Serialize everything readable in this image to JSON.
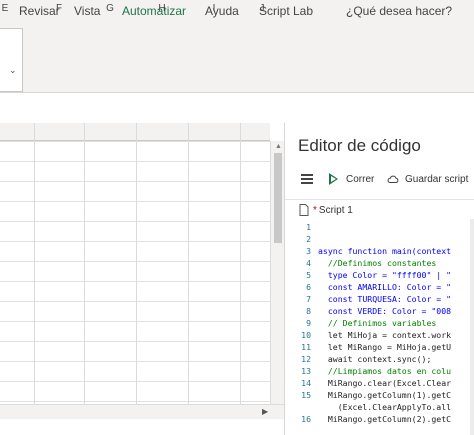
{
  "ribbon": {
    "tabs": [
      "Revisar",
      "Vista",
      "Automatizar",
      "Ayuda",
      "Script Lab",
      "¿Qué desea hacer?"
    ],
    "active_tab": "Automatizar",
    "accent_color": "#217346"
  },
  "sheet": {
    "columns": [
      "E",
      "F",
      "G",
      "H",
      "I",
      "J"
    ]
  },
  "code_editor": {
    "title": "Editor de código",
    "run_label": "Correr",
    "save_label": "Guardar script",
    "script_name": "Script 1",
    "unsaved_marker": "*",
    "line_numbers": [
      "1",
      "2",
      "3",
      "4",
      "5",
      "6",
      "7",
      "8",
      "9",
      "10",
      "11",
      "12",
      "13",
      "14",
      "15",
      "16"
    ],
    "lines": [
      "",
      "",
      "async function main(context",
      "  //Definimos constantes",
      "  type Color = \"ffff00\" | \"",
      "  const AMARILLO: Color = \"",
      "  const TURQUESA: Color = \"",
      "  const VERDE: Color = \"008",
      "  // Definimos variables",
      "  let MiHoja = context.work",
      "  let MiRango = MiHoja.getU",
      "  await context.sync();",
      "  //Limpiamos datos en colu",
      "  MiRango.clear(Excel.Clear",
      "  MiRango.getColumn(1).getC",
      "    (Excel.ClearApplyTo.all",
      "  MiRango.getColumn(2).getC"
    ]
  }
}
